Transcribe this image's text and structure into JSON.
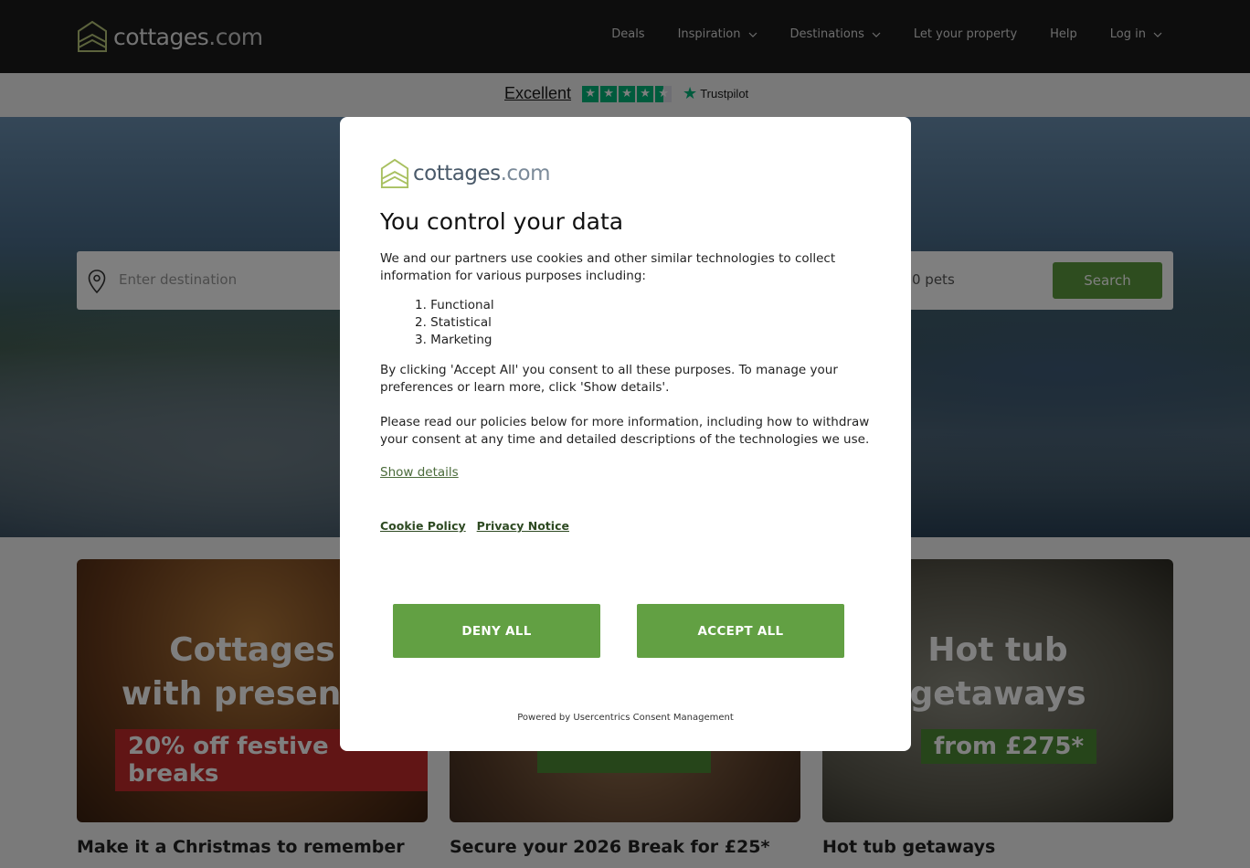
{
  "header": {
    "logo": {
      "word": "cottages",
      "domain": ".com"
    },
    "nav": [
      {
        "label": "Deals",
        "has_chevron": false
      },
      {
        "label": "Inspiration",
        "has_chevron": true
      },
      {
        "label": "Destinations",
        "has_chevron": true
      },
      {
        "label": "Let your property",
        "has_chevron": false
      },
      {
        "label": "Help",
        "has_chevron": false
      },
      {
        "label": "Log in",
        "has_chevron": true
      }
    ]
  },
  "trustpilot": {
    "rating_word": "Excellent",
    "brand": "Trustpilot",
    "stars": 4.5,
    "color": "#00b67a"
  },
  "hero": {
    "search": {
      "destination_placeholder": "Enter destination",
      "pets_value": "0 pets",
      "search_label": "Search"
    }
  },
  "cards": [
    {
      "image_title_1": "Cottages",
      "image_title_2": "with presence",
      "badge": "20% off festive breaks",
      "caption": "Make it a Christmas to remember"
    },
    {
      "caption": "Secure your 2026 Break for £25*"
    },
    {
      "image_title_1": "Hot tub",
      "image_title_2": "getaways",
      "badge": "from £275*",
      "caption": "Hot tub getaways"
    }
  ],
  "consent": {
    "logo": {
      "word": "cottages",
      "domain": ".com"
    },
    "title": "You control your data",
    "intro": "We and our partners use cookies and other similar technologies to collect information for various purposes including:",
    "purposes": [
      "1. Functional",
      "2. Statistical",
      "3. Marketing"
    ],
    "accept_info": "By clicking 'Accept All' you consent to all these purposes. To manage your preferences or learn more, click 'Show details'.",
    "policy_info": "Please read our policies below for more information, including how to withdraw your consent at any time and detailed descriptions of the technologies we use.",
    "show_details": "Show details",
    "cookie_policy": "Cookie Policy",
    "privacy_notice": "Privacy Notice",
    "deny_all": "DENY ALL",
    "accept_all": "ACCEPT ALL",
    "powered_by": "Powered by Usercentrics Consent Management",
    "button_color": "#62a043"
  },
  "colors": {
    "header_bg": "#1b1b1b",
    "brand_green": "#5c9b3f"
  }
}
